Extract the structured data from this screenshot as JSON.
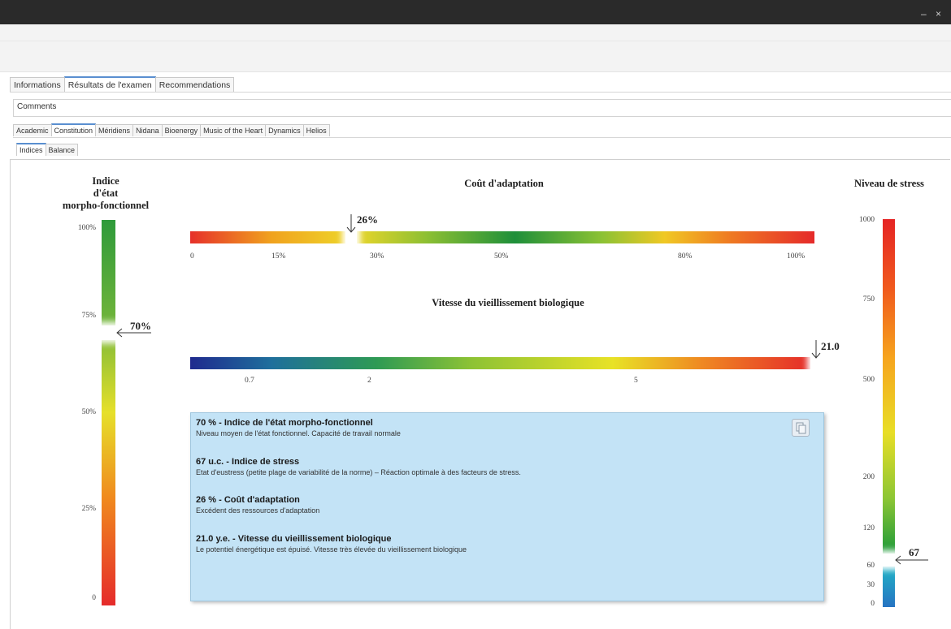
{
  "window": {
    "controls": "– ×"
  },
  "main_tabs": [
    "Informations",
    "Résultats de l'examen",
    "Recommendations"
  ],
  "comments_label": "Comments",
  "method_tabs": [
    "Academic",
    "Constitution",
    "Méridiens",
    "Nidana",
    "Bioenergy",
    "Music of the Heart",
    "Dynamics",
    "Helios"
  ],
  "sub_tabs": [
    "Indices",
    "Balance"
  ],
  "morpho": {
    "title_lines": [
      "Indice",
      "d'état",
      "morpho-fonctionnel"
    ],
    "ticks": [
      "100%",
      "75%",
      "50%",
      "25%",
      "0"
    ],
    "value_label": "70%",
    "value": 70
  },
  "cost": {
    "title": "Coût d'adaptation",
    "ticks": [
      "0",
      "15%",
      "30%",
      "50%",
      "80%",
      "100%"
    ],
    "value_label": "26%",
    "value": 26
  },
  "aging": {
    "title": "Vitesse du vieillissement biologique",
    "ticks": [
      "0.7",
      "2",
      "5"
    ],
    "value_label": "21.0",
    "value": 21.0
  },
  "stress": {
    "title": "Niveau de stress",
    "ticks": [
      "1000",
      "750",
      "500",
      "200",
      "120",
      "60",
      "30",
      "0"
    ],
    "value_label": "67",
    "value": 67
  },
  "summary": [
    {
      "head": "70 % - Indice de l'état morpho-fonctionnel",
      "desc": "Niveau moyen de l'état fonctionnel. Capacité de travail normale"
    },
    {
      "head": "67 u.c. - Indice de stress",
      "desc": "Etat d'eustress (petite plage de variabilité de la norme) – Réaction optimale à des facteurs de stress."
    },
    {
      "head": "26 % - Coût d'adaptation",
      "desc": "Excédent des ressources d'adaptation"
    },
    {
      "head": "21.0 y.e. - Vitesse du vieillissement biologique",
      "desc": "Le potentiel énergétique est épuisé. Vitesse très élevée du vieillissement biologique"
    }
  ],
  "colors": {
    "info_bg": "#c3e3f6",
    "tab_accent": "#5a8fd0",
    "titlebar": "#2a2a2a"
  }
}
